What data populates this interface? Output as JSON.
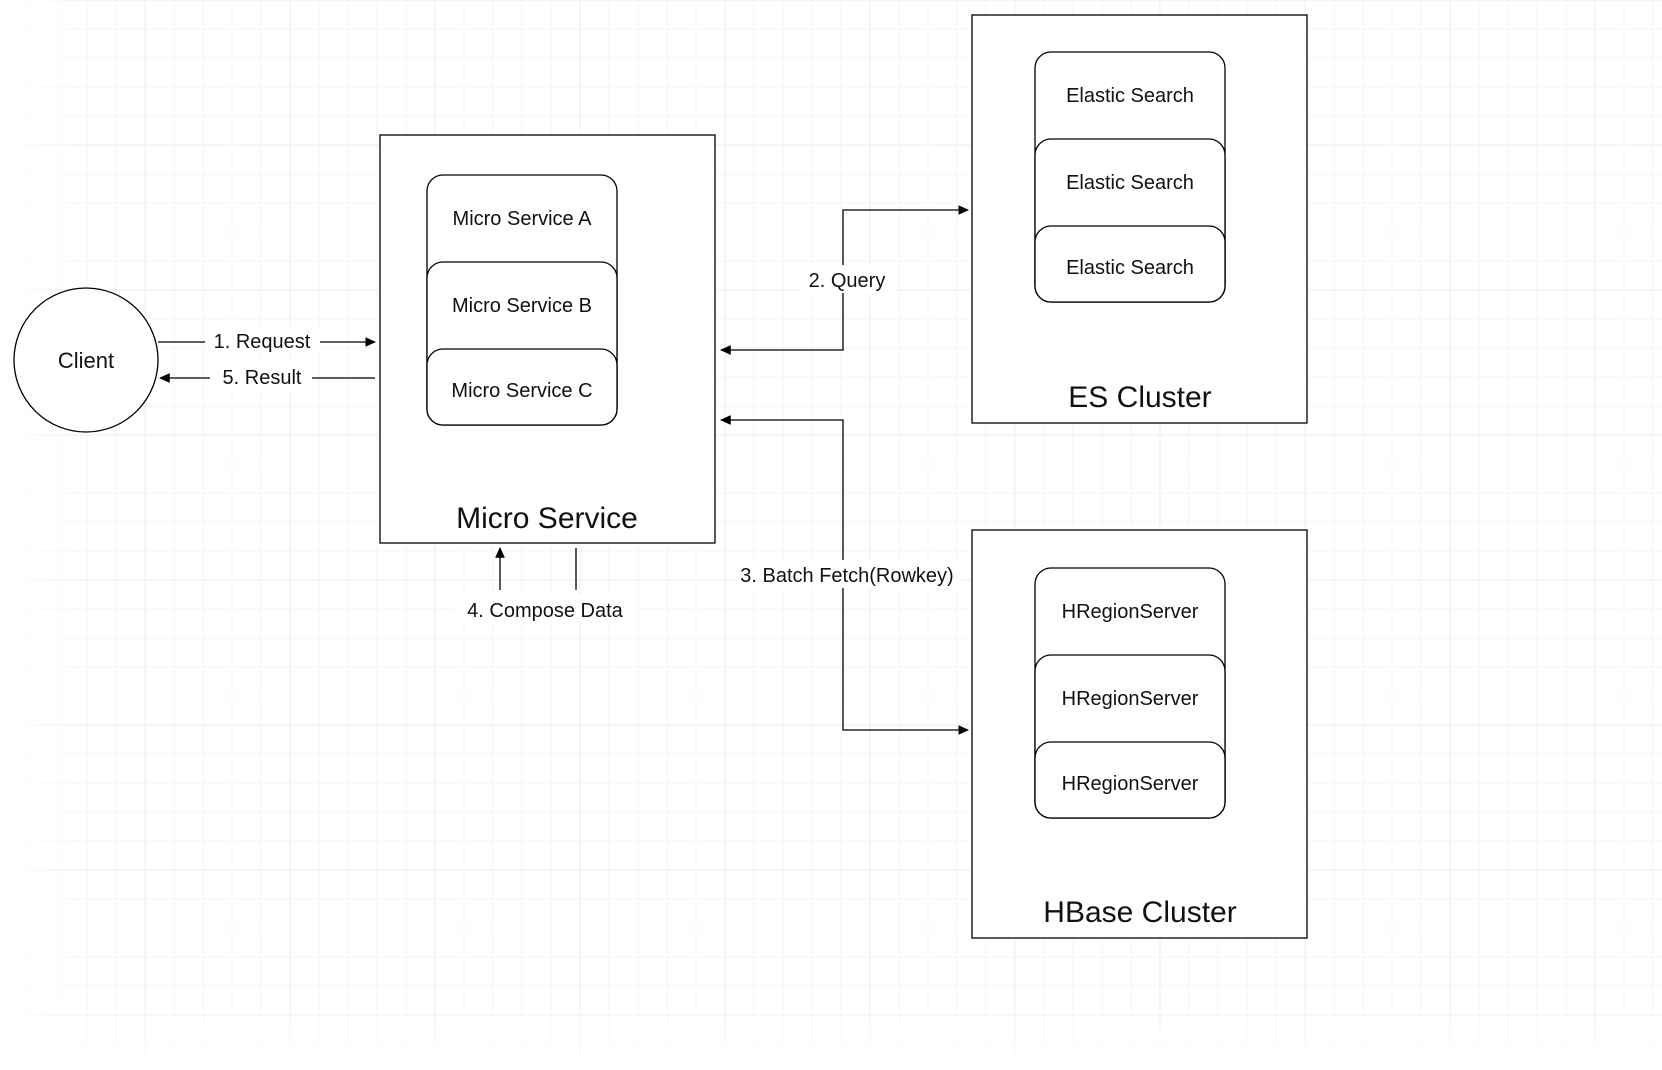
{
  "client": {
    "label": "Client"
  },
  "microservice": {
    "title": "Micro Service",
    "items": [
      "Micro Service A",
      "Micro Service B",
      "Micro Service C"
    ]
  },
  "es_cluster": {
    "title": "ES Cluster",
    "items": [
      "Elastic Search",
      "Elastic Search",
      "Elastic Search"
    ]
  },
  "hbase_cluster": {
    "title": "HBase Cluster",
    "items": [
      "HRegionServer",
      "HRegionServer",
      "HRegionServer"
    ]
  },
  "edges": {
    "request": "1. Request",
    "result": "5. Result",
    "query": "2. Query",
    "batch_fetch": "3. Batch Fetch(Rowkey)",
    "compose": "4. Compose Data"
  }
}
